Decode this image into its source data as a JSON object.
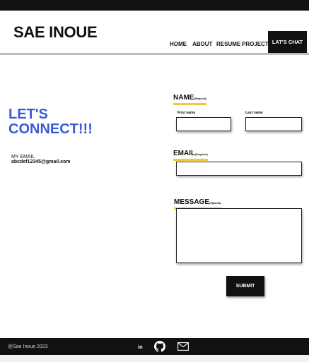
{
  "brand": {
    "name": "SAE INOUE"
  },
  "nav": {
    "home": "HOME",
    "about": "ABOUT",
    "resume": "RESUME",
    "project": "PROJECT",
    "chat": "LAT'S CHAT"
  },
  "contact": {
    "headline_line1": "LET'S",
    "headline_line2": "CONNECT!!!",
    "email_label": "MY EMAIL",
    "email_value": "abcdef12345@gmail.com"
  },
  "form": {
    "name_label": "NAME",
    "name_required": "(Required)",
    "first_name_label": "First name",
    "last_name_label": "Last name",
    "email_label": "EMAIL",
    "email_required": "(Required)",
    "message_label": "MESSAGE",
    "message_optional": "(Optional)",
    "submit_label": "SUBMIT"
  },
  "footer": {
    "copyright": "@Sae Inoue 2023",
    "linkedin_text": "in",
    "icons": [
      "linkedin-icon",
      "github-icon",
      "mail-icon"
    ]
  },
  "colors": {
    "accent_blue": "#3b5bd6",
    "highlight_yellow": "#f0c93a",
    "dark": "#111111"
  }
}
